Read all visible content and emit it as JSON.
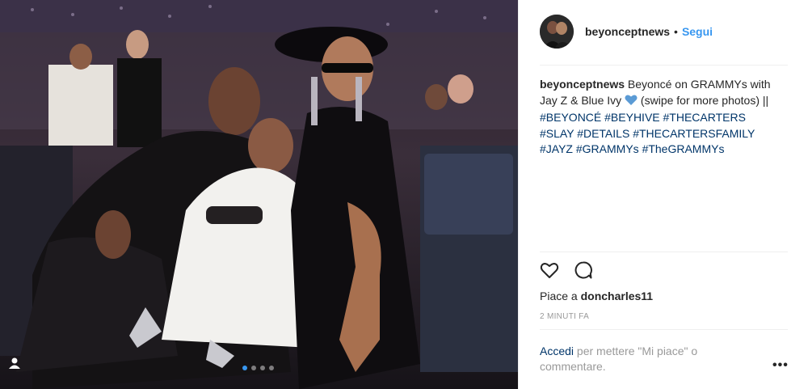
{
  "header": {
    "username": "beyonceptnews",
    "separator": "•",
    "follow_label": "Segui"
  },
  "caption": {
    "username": "beyonceptnews",
    "text_1": " Beyoncé on GRAMMYs with Jay Z & Blue Ivy ",
    "emoji": "blue-heart",
    "text_2": " (swipe for more photos) || ",
    "hashtags": [
      "#BEYONCÉ",
      "#BEYHIVE",
      "#THECARTERS",
      "#SLAY",
      "#DETAILS",
      "#THECARTERSFAMILY",
      "#JAYZ",
      "#GRAMMYs",
      "#TheGRAMMYs"
    ]
  },
  "actions": {
    "like_icon": "heart-outline-icon",
    "comment_icon": "comment-bubble-icon"
  },
  "likes": {
    "prefix": "Piace a ",
    "liker": "doncharles11"
  },
  "timestamp": "2 MINUTI FA",
  "comment_prompt": {
    "login_link": "Accedi",
    "text": " per mettere \"Mi piace\" o commentare."
  },
  "more_label": "•••",
  "carousel": {
    "count": 4,
    "active": 1
  },
  "colors": {
    "link": "#3897f0",
    "hashtag": "#003569",
    "muted": "#999999",
    "heart_emoji": "#5b9bd5"
  }
}
